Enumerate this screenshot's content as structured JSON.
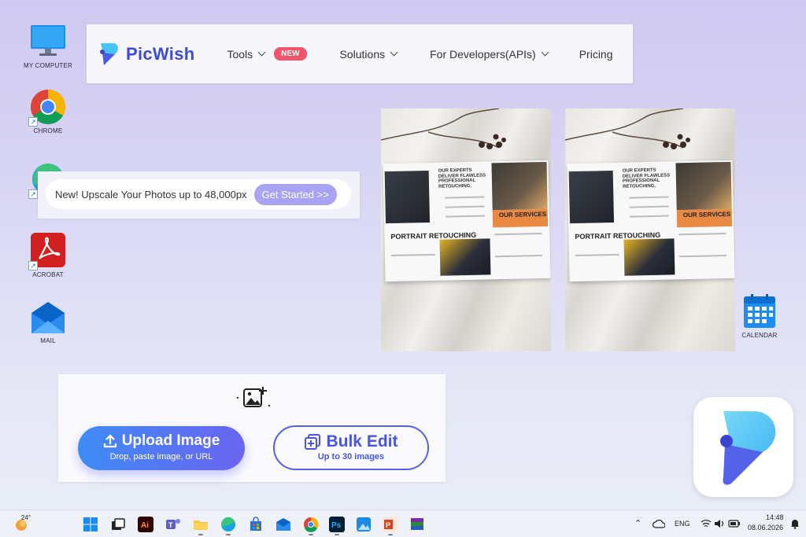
{
  "desktop": {
    "icons": [
      {
        "label": "MY COMPUTER"
      },
      {
        "label": "CHROME"
      },
      {
        "label": "ACROBAT"
      },
      {
        "label": "MAIL"
      },
      {
        "label": "CALENDAR"
      }
    ]
  },
  "nav": {
    "brand": "PicWish",
    "tools_label": "Tools",
    "new_badge": "NEW",
    "solutions_label": "Solutions",
    "developers_label": "For Developers(APIs)",
    "pricing_label": "Pricing"
  },
  "banner": {
    "text": "New! Upscale Your Photos up to 48,000px",
    "button": "Get Started >>"
  },
  "poster": {
    "headline": "OUR EXPERTS DELIVER FLAWLESS PROFESSIONAL RETOUCHING.",
    "services": "OUR SERVICES",
    "title": "PORTRAIT RETOUCHING"
  },
  "upload": {
    "upload_title": "Upload Image",
    "upload_sub": "Drop, paste image, or URL",
    "bulk_title": "Bulk Edit",
    "bulk_sub": "Up to 30 images"
  },
  "taskbar": {
    "weather": "24°",
    "language": "ENG",
    "time": "14:48",
    "date": "08.06.2026"
  },
  "colors": {
    "brand": "#3d4ad6",
    "new_badge": "#f2546c",
    "banner_button": "#a8a3f3",
    "upload_gradient_start": "#3f8bf6",
    "upload_gradient_end": "#6a64f0"
  }
}
